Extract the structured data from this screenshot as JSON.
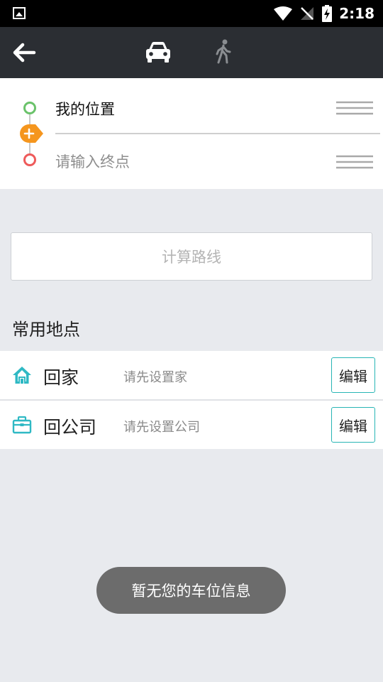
{
  "status_bar": {
    "time": "2:18"
  },
  "toolbar": {
    "back_icon": "arrow-left-icon",
    "modes": [
      {
        "icon": "car-icon",
        "active": true
      },
      {
        "icon": "walk-icon",
        "active": false
      }
    ]
  },
  "route": {
    "start_label": "我的位置",
    "end_placeholder": "请输入终点",
    "end_value": ""
  },
  "calc_button": {
    "label": "计算路线"
  },
  "common_places": {
    "title": "常用地点",
    "items": [
      {
        "icon": "home-icon",
        "name": "回家",
        "hint": "请先设置家",
        "edit_label": "编辑"
      },
      {
        "icon": "briefcase-icon",
        "name": "回公司",
        "hint": "请先设置公司",
        "edit_label": "编辑"
      }
    ]
  },
  "toast": {
    "text": "暂无您的车位信息"
  },
  "colors": {
    "accent": "#28b5b5",
    "start_dot": "#6ac26a",
    "end_dot": "#ee5a5a",
    "via_add": "#f5961e",
    "toolbar_bg": "#2b2e33",
    "page_bg": "#e8eaee"
  }
}
